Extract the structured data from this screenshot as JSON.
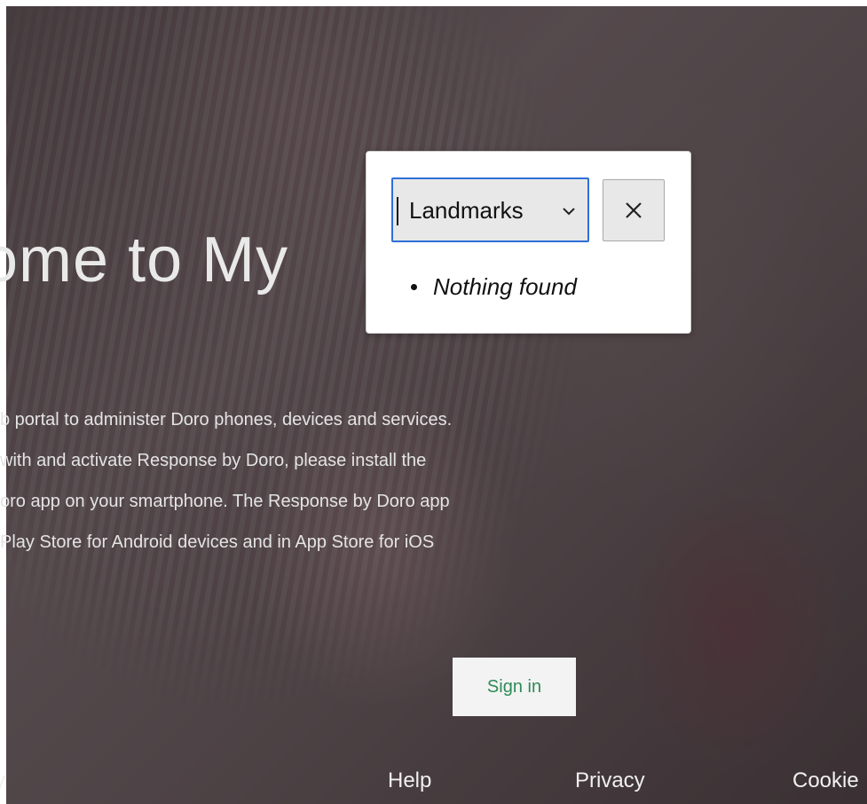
{
  "hero": {
    "heading": "ome to My",
    "paragraph_lines": [
      "b portal to administer Doro phones, devices and services.",
      "with and activate Response by Doro, please install the",
      "oro app on your smartphone. The Response by Doro app",
      " Play Store for Android devices and in App Store for iOS"
    ],
    "sign_in_label": "Sign in"
  },
  "footer": {
    "links": [
      "y",
      "Help",
      "Privacy",
      "Cookie"
    ]
  },
  "landmarks_popup": {
    "select_value": "Landmarks",
    "close_label": "×",
    "results": [
      "Nothing found"
    ]
  },
  "colors": {
    "focus_outline": "#2f6fd6",
    "sign_in_text": "#2e8b57"
  },
  "icons": {
    "select_chevron": "chevron-down-icon",
    "close": "close-icon"
  }
}
